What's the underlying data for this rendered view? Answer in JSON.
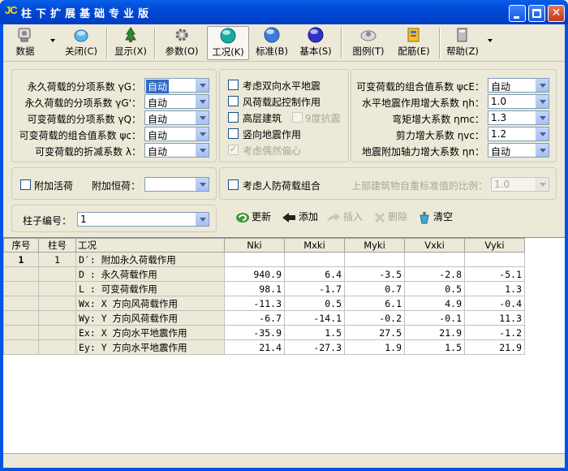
{
  "window": {
    "logo": "JC",
    "title": "柱下扩展基础专业版"
  },
  "toolbar": [
    {
      "label": "数据",
      "icon": "data-icon"
    },
    {
      "label": "关闭(C)",
      "icon": "close-file-icon"
    },
    {
      "label": "显示(X)",
      "icon": "display-icon"
    },
    {
      "label": "参数(O)",
      "icon": "gear-icon"
    },
    {
      "label": "工况(K)",
      "icon": "loadcase-icon"
    },
    {
      "label": "标准(B)",
      "icon": "standard-icon"
    },
    {
      "label": "基本(S)",
      "icon": "basic-icon"
    },
    {
      "label": "图例(T)",
      "icon": "legend-icon"
    },
    {
      "label": "配筋(E)",
      "icon": "rebar-icon"
    },
    {
      "label": "帮助(Z)",
      "icon": "help-icon"
    }
  ],
  "left_params": [
    {
      "label": "永久荷载的分项系数 γG：",
      "value": "自动"
    },
    {
      "label": "永久荷载的分项系数 γG'：",
      "value": "自动"
    },
    {
      "label": "可变荷载的分项系数 γQ：",
      "value": "自动"
    },
    {
      "label": "可变荷载的组合值系数 ψc：",
      "value": "自动"
    },
    {
      "label": "可变荷载的折减系数 λ：",
      "value": "自动"
    }
  ],
  "checkboxes": [
    {
      "label": "考虑双向水平地震",
      "checked": false,
      "enabled": true
    },
    {
      "label": "风荷载起控制作用",
      "checked": false,
      "enabled": true
    },
    {
      "label": "高层建筑",
      "checked": false,
      "enabled": true
    },
    {
      "label": "9度抗震",
      "checked": false,
      "enabled": false
    },
    {
      "label": "竖向地震作用",
      "checked": false,
      "enabled": true
    },
    {
      "label": "考虑偶然偏心",
      "checked": true,
      "enabled": false
    }
  ],
  "right_params": [
    {
      "label": "可变荷载的组合值系数 ψcE：",
      "value": "自动"
    },
    {
      "label": "水平地震作用增大系数 ηh：",
      "value": "1.0"
    },
    {
      "label": "弯矩增大系数 ηmc：",
      "value": "1.3"
    },
    {
      "label": "剪力增大系数 ηvc：",
      "value": "1.2"
    },
    {
      "label": "地震附加轴力增大系数 ηn：",
      "value": "自动"
    }
  ],
  "extra": {
    "live_load_label": "附加活荷",
    "dead_load_label": "附加恒荷：",
    "dead_load_value": "",
    "civil_defense_label": "考虑人防荷载组合",
    "ratio_label": "上部建筑物自重标准值的比例：",
    "ratio_value": "1.0"
  },
  "column": {
    "label": "柱子编号：",
    "value": "1"
  },
  "actions": {
    "refresh": "更新",
    "add": "添加",
    "insert": "插入",
    "delete": "删除",
    "clear": "清空"
  },
  "table": {
    "headers": [
      "序号",
      "柱号",
      "工况",
      "Nki",
      "Mxki",
      "Myki",
      "Vxki",
      "Vyki"
    ],
    "rows": [
      {
        "seq": "1",
        "col": "1",
        "case": "D′: 附加永久荷载作用",
        "v": [
          "",
          "",
          "",
          "",
          ""
        ]
      },
      {
        "seq": "",
        "col": "",
        "case": "D : 永久荷载作用",
        "v": [
          "940.9",
          "6.4",
          "-3.5",
          "-2.8",
          "-5.1"
        ]
      },
      {
        "seq": "",
        "col": "",
        "case": "L : 可变荷载作用",
        "v": [
          "98.1",
          "-1.7",
          "0.7",
          "0.5",
          "1.3"
        ]
      },
      {
        "seq": "",
        "col": "",
        "case": "Wx: X 方向风荷载作用",
        "v": [
          "-11.3",
          "0.5",
          "6.1",
          "4.9",
          "-0.4"
        ]
      },
      {
        "seq": "",
        "col": "",
        "case": "Wy: Y 方向风荷载作用",
        "v": [
          "-6.7",
          "-14.1",
          "-0.2",
          "-0.1",
          "11.3"
        ]
      },
      {
        "seq": "",
        "col": "",
        "case": "Ex: X 方向水平地震作用",
        "v": [
          "-35.9",
          "1.5",
          "27.5",
          "21.9",
          "-1.2"
        ]
      },
      {
        "seq": "",
        "col": "",
        "case": "Ey: Y 方向水平地震作用",
        "v": [
          "21.4",
          "-27.3",
          "1.9",
          "1.5",
          "21.9"
        ]
      }
    ]
  },
  "colors": {
    "title_bar": "#0054E3",
    "face": "#ECE9D8",
    "highlight": "#316AC5"
  }
}
